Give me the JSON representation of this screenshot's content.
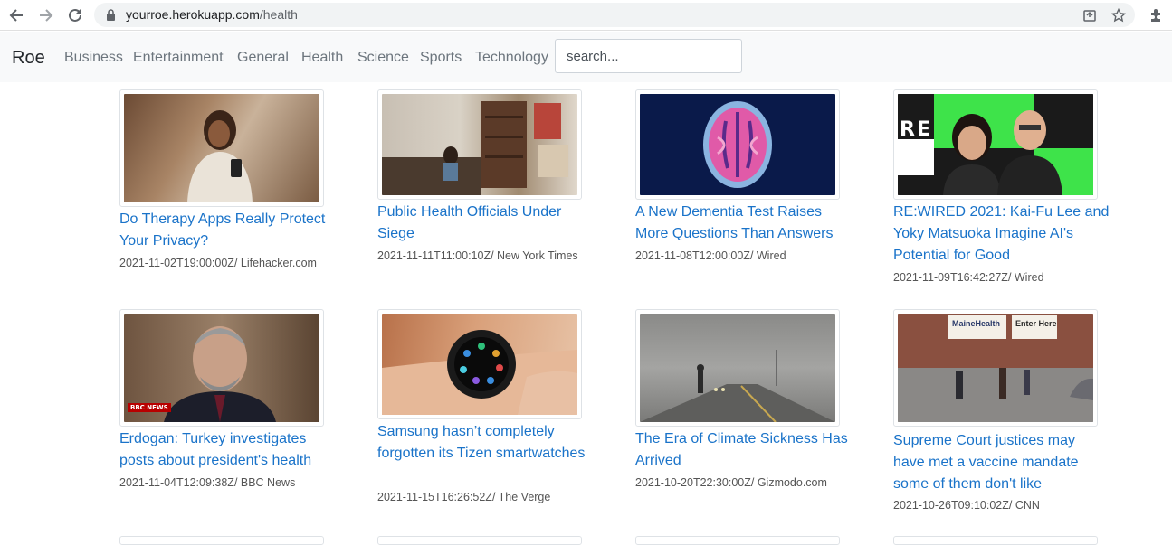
{
  "browser": {
    "url_host": "yourroe.herokuapp.com",
    "url_path": "/health"
  },
  "navbar": {
    "brand": "Roe",
    "items": [
      "Business",
      "Entertainment",
      "General",
      "Health",
      "Science",
      "Sports",
      "Technology"
    ],
    "search_placeholder": "search..."
  },
  "articles": [
    {
      "title": "Do Therapy Apps Really Protect Your Privacy?",
      "meta": "2021-11-02T19:00:00Z/ Lifehacker.com"
    },
    {
      "title": "Public Health Officials Under Siege",
      "meta": "2021-11-11T11:00:10Z/ New York Times"
    },
    {
      "title": "A New Dementia Test Raises More Questions Than Answers",
      "meta": "2021-11-08T12:00:00Z/ Wired"
    },
    {
      "title": "RE:WIRED 2021: Kai-Fu Lee and Yoky Matsuoka Imagine AI's Potential for Good",
      "meta": "2021-11-09T16:42:27Z/ Wired"
    },
    {
      "title": "Erdogan: Turkey investigates posts about president's health",
      "meta": "2021-11-04T12:09:38Z/ BBC News"
    },
    {
      "title": "Samsung hasn’t completely forgotten its Tizen smartwatches",
      "meta": "2021-11-15T16:26:52Z/ The Verge"
    },
    {
      "title": "The Era of Climate Sickness Has Arrived",
      "meta": "2021-10-20T22:30:00Z/ Gizmodo.com"
    },
    {
      "title": "Supreme Court justices may have met a vaccine mandate some of them don't like",
      "meta": "2021-10-26T09:10:02Z/ CNN"
    }
  ],
  "image_text": {
    "bbc_logo": "BBC NEWS",
    "rewired": "RE W",
    "mainehealth": "MaineHealth",
    "enter_here": "Enter Here"
  }
}
